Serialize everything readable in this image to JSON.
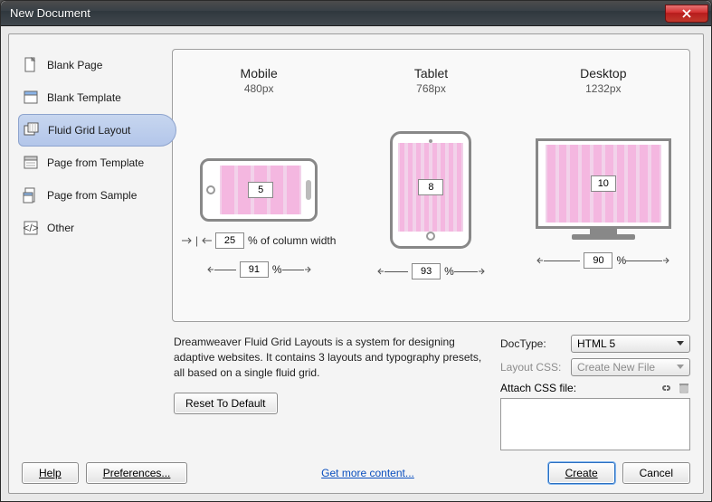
{
  "window": {
    "title": "New Document"
  },
  "sidebar": {
    "items": [
      {
        "label": "Blank Page"
      },
      {
        "label": "Blank Template"
      },
      {
        "label": "Fluid Grid Layout"
      },
      {
        "label": "Page from Template"
      },
      {
        "label": "Page from Sample"
      },
      {
        "label": "Other"
      }
    ]
  },
  "devices": {
    "mobile": {
      "title": "Mobile",
      "resolution": "480px",
      "columns": "5",
      "column_width": "25",
      "column_width_suffix": "% of column width",
      "percent": "91",
      "pct_suffix": "%"
    },
    "tablet": {
      "title": "Tablet",
      "resolution": "768px",
      "columns": "8",
      "percent": "93",
      "pct_suffix": "%"
    },
    "desktop": {
      "title": "Desktop",
      "resolution": "1232px",
      "columns": "10",
      "percent": "90",
      "pct_suffix": "%"
    }
  },
  "description": "Dreamweaver Fluid Grid Layouts is a system for designing adaptive websites. It contains 3 layouts and typography presets, all based on a single fluid grid.",
  "reset_label": "Reset To Default",
  "form": {
    "doctype_label": "DocType:",
    "doctype_value": "HTML 5",
    "layoutcss_label": "Layout CSS:",
    "layoutcss_value": "Create New File",
    "attach_label": "Attach CSS file:"
  },
  "footer": {
    "help": "Help",
    "prefs": "Preferences...",
    "more": "Get more content...",
    "create": "Create",
    "cancel": "Cancel"
  }
}
